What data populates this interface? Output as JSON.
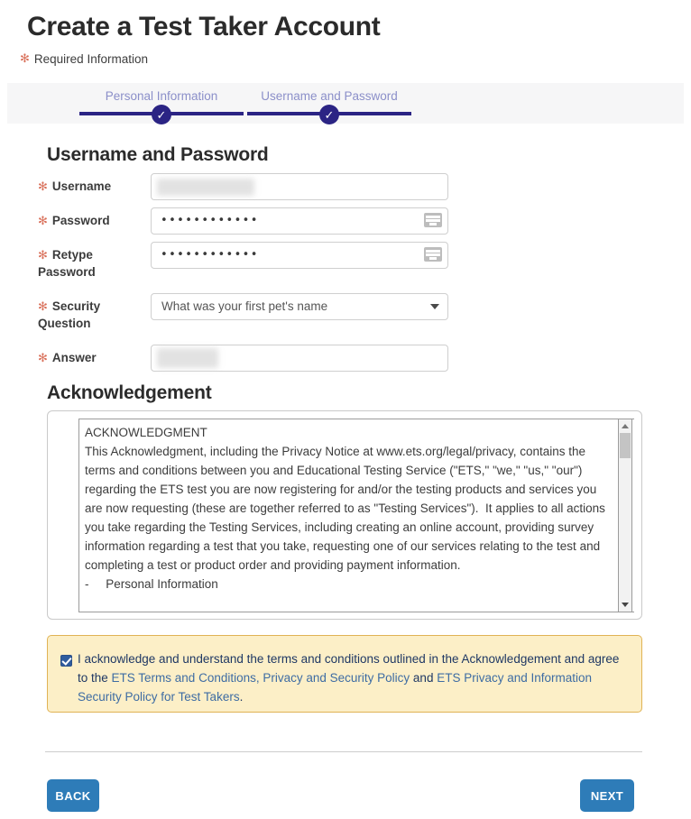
{
  "header": {
    "title": "Create a Test Taker Account",
    "required_note": "Required Information",
    "required_star": "✻"
  },
  "progress": {
    "steps": [
      {
        "label": "Personal Information",
        "state": "complete",
        "check": "✓"
      },
      {
        "label": "Username and Password",
        "state": "complete",
        "check": "✓"
      }
    ]
  },
  "sections": {
    "username_password_heading": "Username and Password",
    "acknowledgement_heading": "Acknowledgement"
  },
  "form": {
    "required_star": "✻",
    "fields": [
      {
        "label": "Username",
        "type": "text",
        "value": "",
        "redacted": true
      },
      {
        "label": "Password",
        "type": "password",
        "value": "••••••••••••",
        "keyboard_icon": "keyboard-icon"
      },
      {
        "label": "Retype Password",
        "type": "password",
        "value": "••••••••••••",
        "keyboard_icon": "keyboard-icon"
      },
      {
        "label": "Security Question",
        "type": "select",
        "value": "What was your first pet's name",
        "arrow_icon": "chevron-down-icon"
      },
      {
        "label": "Answer",
        "type": "text",
        "value": "",
        "redacted": true
      }
    ]
  },
  "acknowledgement": {
    "body": "ACKNOWLEDGMENT\nThis Acknowledgment, including the Privacy Notice at www.ets.org/legal/privacy, contains the terms and conditions between you and Educational Testing Service (\"ETS,\" \"we,\" \"us,\" \"our\") regarding the ETS test you are now registering for and/or the testing products and services you are now requesting (these are together referred to as \"Testing Services\").  It applies to all actions you take regarding the Testing Services, including creating an online account, providing survey information regarding a test that you take, requesting one of our services relating to the test and completing a test or product order and providing payment information.\n-     Personal Information",
    "scrollbar": {
      "up_arrow": "scroll-up-arrow-icon",
      "down_arrow": "scroll-down-arrow-icon"
    }
  },
  "consent": {
    "checked": true,
    "text_part_1": "I acknowledge and understand the terms and conditions outlined in the Acknowledgement and agree to the ",
    "link_1": "ETS Terms and Conditions, Privacy and Security Policy",
    "text_part_2": " and ",
    "link_2": "ETS Privacy and Information Security Policy for Test Takers",
    "text_part_3": "."
  },
  "footer": {
    "back_label": "BACK",
    "next_label": "NEXT"
  },
  "colors": {
    "accent_blue": "#2e7cb8",
    "progress_navy": "#2b2484",
    "step_label": "#8b8fc9",
    "required_star": "#d9705a",
    "consent_bg": "#fcefc7",
    "consent_border": "#e0b355",
    "consent_text": "#1f3864",
    "link": "#3e6ca3"
  }
}
